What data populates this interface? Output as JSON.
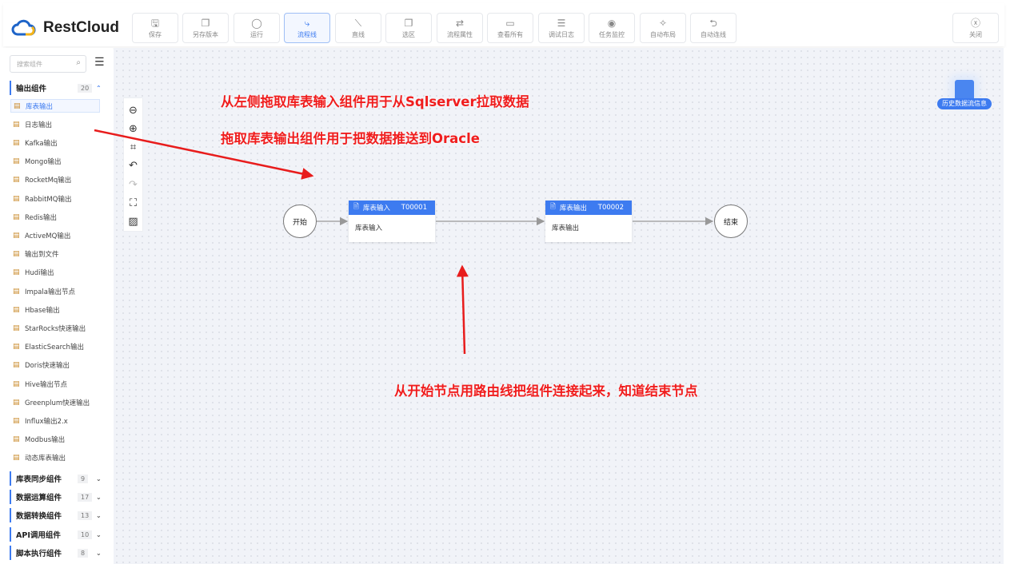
{
  "header": {
    "brand": "RestCloud",
    "toolbar": [
      {
        "label": "保存",
        "icon": "save-icon",
        "glyph": "🖫"
      },
      {
        "label": "另存版本",
        "icon": "copy-check-icon",
        "glyph": "❐"
      },
      {
        "label": "运行",
        "icon": "run-icon",
        "glyph": "◯"
      },
      {
        "label": "流程线",
        "icon": "flow-line-icon",
        "glyph": "⤷",
        "active": true
      },
      {
        "label": "直线",
        "icon": "straight-line-icon",
        "glyph": "⟍"
      },
      {
        "label": "选区",
        "icon": "select-area-icon",
        "glyph": "❐"
      },
      {
        "label": "流程属性",
        "icon": "flow-properties-icon",
        "glyph": "⇄"
      },
      {
        "label": "查看所有",
        "icon": "view-all-icon",
        "glyph": "▭"
      },
      {
        "label": "调试日志",
        "icon": "debug-log-icon",
        "glyph": "☰"
      },
      {
        "label": "任务监控",
        "icon": "task-monitor-icon",
        "glyph": "◉"
      },
      {
        "label": "自动布局",
        "icon": "magic-wand-icon",
        "glyph": "✧"
      },
      {
        "label": "自动连线",
        "icon": "auto-connect-icon",
        "glyph": "⮌"
      }
    ],
    "close_label": "关闭"
  },
  "sidebar": {
    "search_placeholder": "搜索组件",
    "sections": [
      {
        "title": "输出组件",
        "count": "20",
        "expanded": true
      },
      {
        "title": "库表同步组件",
        "count": "9"
      },
      {
        "title": "数据运算组件",
        "count": "17"
      },
      {
        "title": "数据转换组件",
        "count": "13"
      },
      {
        "title": "API调用组件",
        "count": "10"
      },
      {
        "title": "脚本执行组件",
        "count": "8"
      }
    ],
    "items": [
      "库表输出",
      "日志输出",
      "Kafka输出",
      "Mongo输出",
      "RocketMq输出",
      "RabbitMQ输出",
      "Redis输出",
      "ActiveMQ输出",
      "输出到文件",
      "Hudi输出",
      "Impala输出节点",
      "Hbase输出",
      "StarRocks快速输出",
      "ElasticSearch输出",
      "Doris快速输出",
      "Hive输出节点",
      "Greenplum快速输出",
      "Influx输出2.x",
      "Modbus输出",
      "动态库表输出"
    ]
  },
  "canvas": {
    "notes": [
      "从左侧拖取库表输入组件用于从Sqlserver拉取数据",
      "拖取库表输出组件用于把数据推送到Oracle",
      "从开始节点用路由线把组件连接起来，知道结束节点"
    ],
    "start_label": "开始",
    "end_label": "结束",
    "nodes": [
      {
        "title": "库表输入",
        "id": "T00001",
        "body": "库表输入"
      },
      {
        "title": "库表输出",
        "id": "T00002",
        "body": "库表输出"
      }
    ],
    "history_label": "历史数据流信息"
  },
  "colors": {
    "accent": "#3d7bf0",
    "annotation": "#f01e1e"
  }
}
